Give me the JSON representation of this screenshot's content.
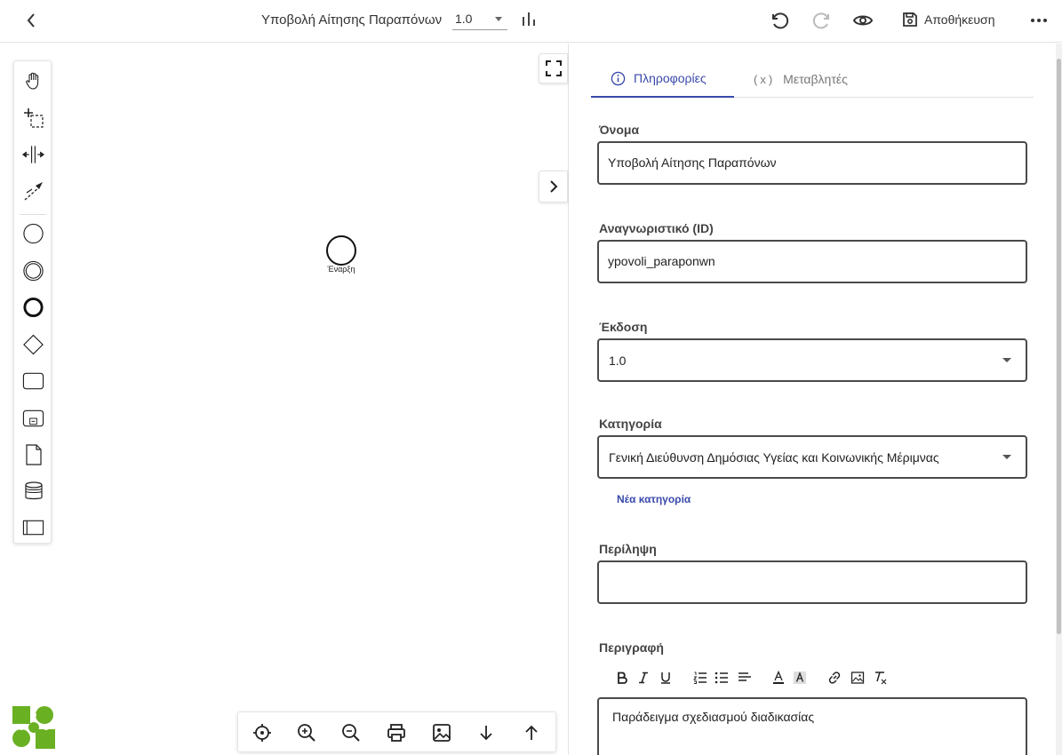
{
  "header": {
    "process_title": "Υποβολή Αίτησης Παραπόνων",
    "version": "1.0",
    "save_label": "Αποθήκευση"
  },
  "canvas": {
    "start_event_label": "Έναρξη"
  },
  "panel": {
    "tabs": [
      {
        "label": "Πληροφορίες",
        "icon": "info-icon",
        "active": true
      },
      {
        "label": "Μεταβλητές",
        "icon": "variable-x-icon",
        "prefix": "(x)",
        "active": false
      }
    ],
    "name": {
      "label": "Όνομα",
      "value": "Υποβολή Αίτησης Παραπόνων"
    },
    "id": {
      "label": "Αναγνωριστικό (ID)",
      "value": "ypovoli_paraponwn"
    },
    "version": {
      "label": "Έκδοση",
      "value": "1.0"
    },
    "category": {
      "label": "Κατηγορία",
      "value": "Γενική Διεύθυνση Δημόσιας Υγείας και Κοινωνικής Μέριμνας",
      "new_label": "Νέα κατηγορία"
    },
    "summary": {
      "label": "Περίληψη",
      "value": ""
    },
    "description": {
      "label": "Περιγραφή",
      "value": "Παράδειγμα σχεδιασμού διαδικασίας"
    }
  },
  "colors": {
    "accent": "#3949ab",
    "logo_green": "#6ab023"
  }
}
